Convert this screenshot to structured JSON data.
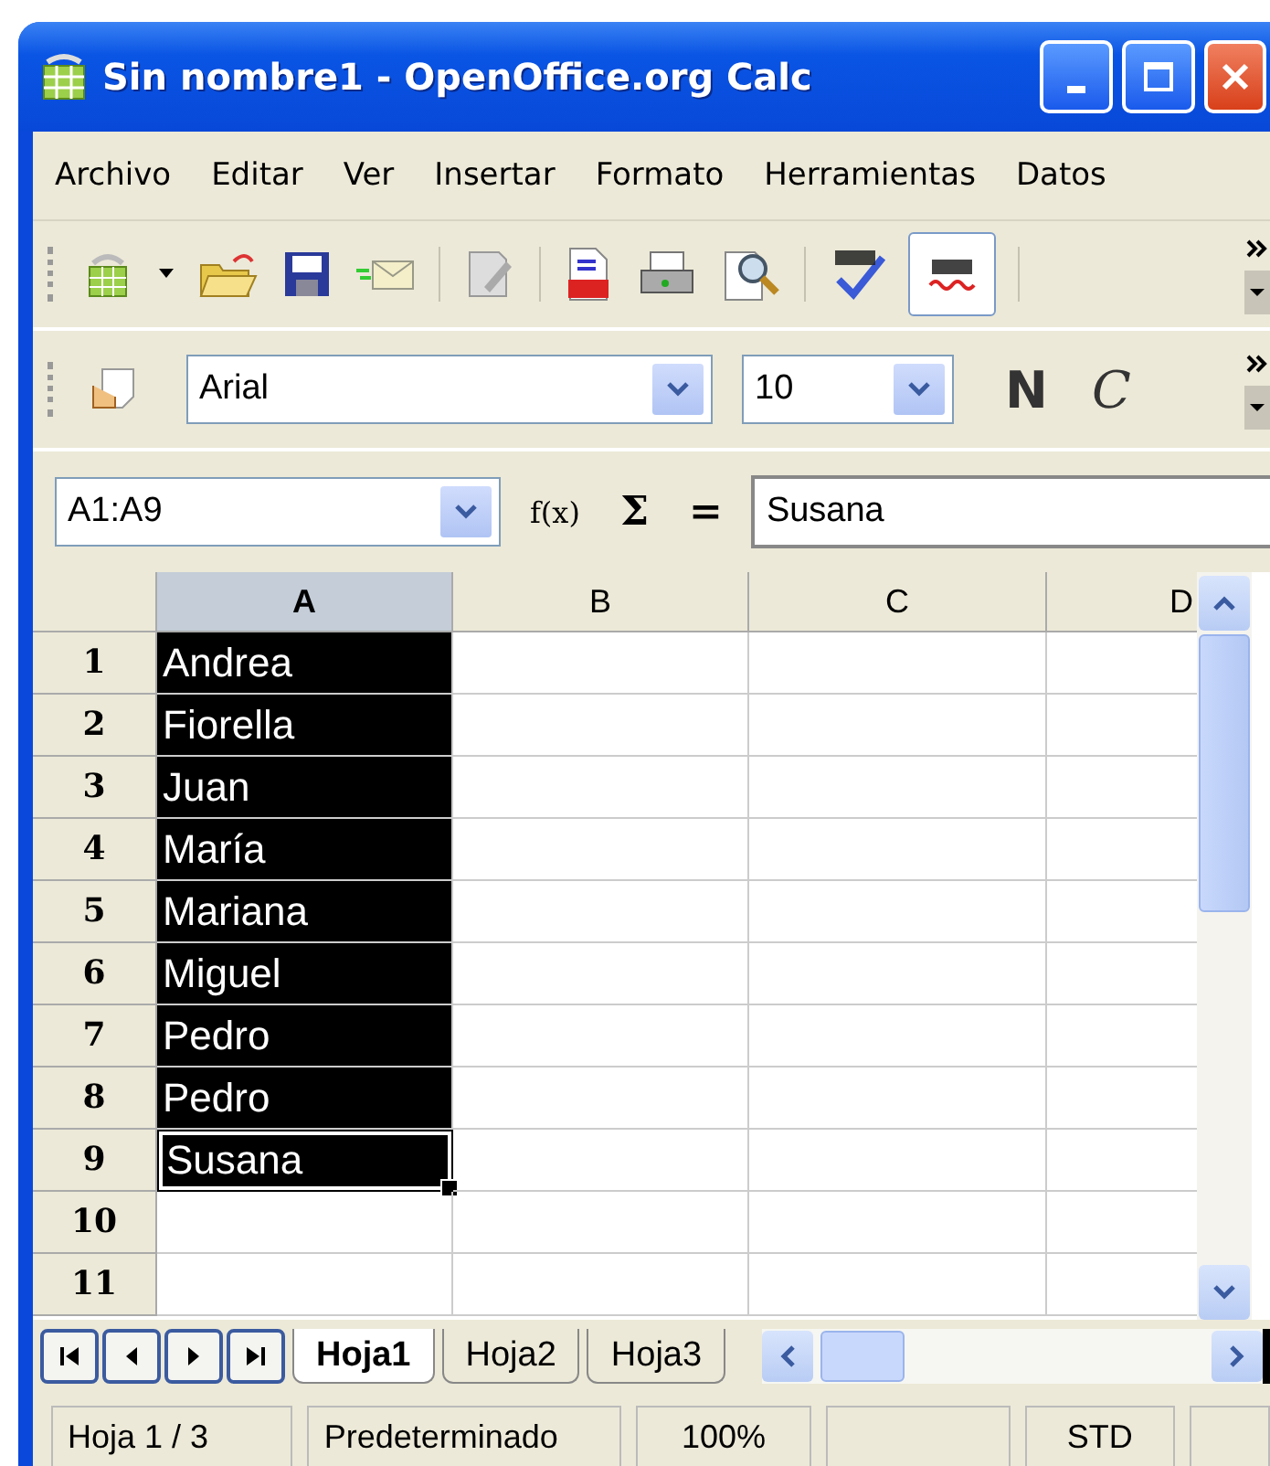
{
  "window": {
    "title": "Sin nombre1 - OpenOffice.org Calc"
  },
  "menu": [
    "Archivo",
    "Editar",
    "Ver",
    "Insertar",
    "Formato",
    "Herramientas",
    "Datos"
  ],
  "toolbar": {
    "auto_spellcheck_on": true
  },
  "format_bar": {
    "font": "Arial",
    "size": "10",
    "bold": "N",
    "italic": "C"
  },
  "formula_bar": {
    "name_box": "A1:A9",
    "function_icon": "f(x)",
    "sum": "Σ",
    "equals": "=",
    "input": "Susana"
  },
  "columns": [
    {
      "label": "A",
      "selected": true
    },
    {
      "label": "B",
      "selected": false
    },
    {
      "label": "C",
      "selected": false
    },
    {
      "label": "D",
      "selected": false
    }
  ],
  "rows": [
    {
      "number": "1",
      "a": "Andrea",
      "selected": true,
      "cursor": false
    },
    {
      "number": "2",
      "a": "Fiorella",
      "selected": true,
      "cursor": false
    },
    {
      "number": "3",
      "a": "Juan",
      "selected": true,
      "cursor": false
    },
    {
      "number": "4",
      "a": "María",
      "selected": true,
      "cursor": false
    },
    {
      "number": "5",
      "a": "Mariana",
      "selected": true,
      "cursor": false
    },
    {
      "number": "6",
      "a": "Miguel",
      "selected": true,
      "cursor": false
    },
    {
      "number": "7",
      "a": "Pedro",
      "selected": true,
      "cursor": false
    },
    {
      "number": "8",
      "a": "Pedro",
      "selected": true,
      "cursor": false
    },
    {
      "number": "9",
      "a": "Susana",
      "selected": true,
      "cursor": true
    },
    {
      "number": "10",
      "selected": false,
      "cursor": false
    },
    {
      "number": "11",
      "selected": false,
      "cursor": false
    }
  ],
  "sheet_tabs": [
    {
      "label": "Hoja1",
      "selected": true
    },
    {
      "label": "Hoja2",
      "selected": false
    },
    {
      "label": "Hoja3",
      "selected": false
    }
  ],
  "status_bar": {
    "sheet": "Hoja 1 / 3",
    "page_style": "Predeterminado",
    "zoom": "100%",
    "selection_mode": "STD"
  }
}
